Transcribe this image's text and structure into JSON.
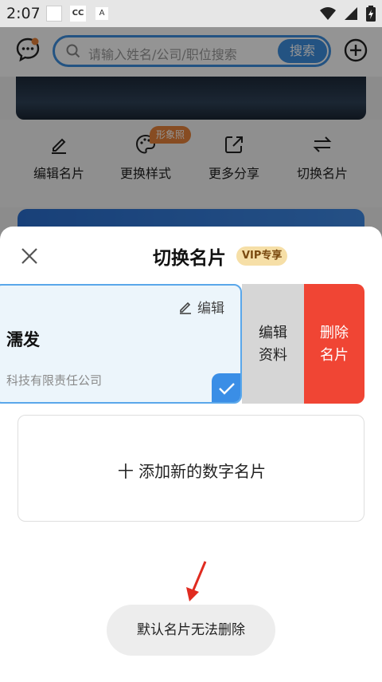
{
  "status_bar": {
    "time": "2:07",
    "cc_label": "CC",
    "a_label": "A"
  },
  "header": {
    "search_placeholder": "请输入姓名/公司/职位搜索",
    "search_button": "搜索"
  },
  "actions": [
    {
      "label": "编辑名片",
      "icon": "pen-icon"
    },
    {
      "label": "更换样式",
      "icon": "palette-icon",
      "badge": "形象照"
    },
    {
      "label": "更多分享",
      "icon": "share-icon"
    },
    {
      "label": "切换名片",
      "icon": "swap-icon"
    }
  ],
  "sheet": {
    "title": "切换名片",
    "vip_badge": "VIP专享",
    "card": {
      "edit_label": "编辑",
      "name": "濡发",
      "company": "科技有限责任公司"
    },
    "swipe_edit": "编辑资料",
    "swipe_delete": "删除名片",
    "add_new": "十 添加新的数字名片",
    "toast": "默认名片无法删除"
  },
  "colors": {
    "accent": "#3d8fe0",
    "delete": "#f04534",
    "vip": "#f6dfa7"
  }
}
